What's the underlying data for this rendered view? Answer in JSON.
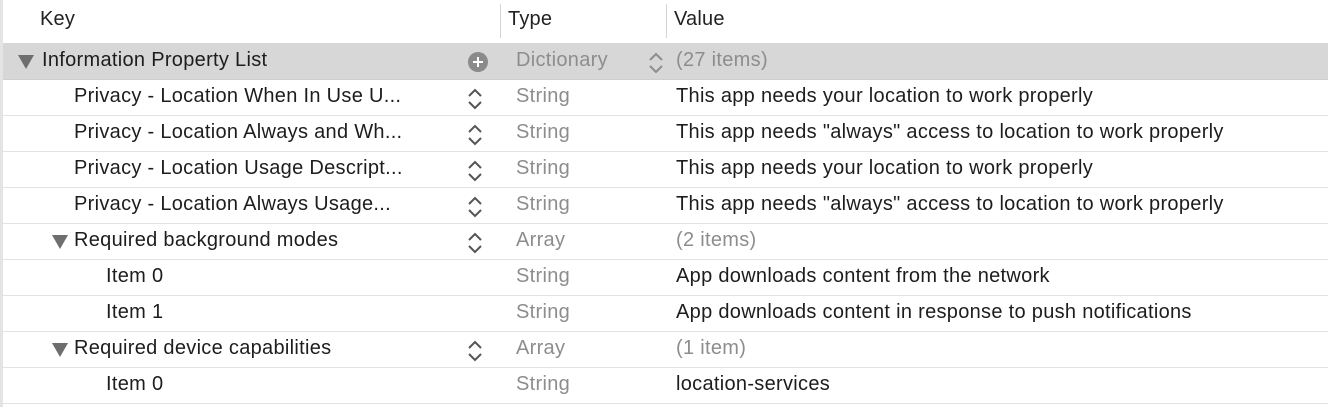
{
  "header": {
    "key_label": "Key",
    "type_label": "Type",
    "value_label": "Value"
  },
  "rows": [
    {
      "key": "Information Property List",
      "type": "Dictionary",
      "value": "(27 items)"
    },
    {
      "key": "Privacy - Location When In Use U...",
      "type": "String",
      "value": "This app needs your location to work properly"
    },
    {
      "key": "Privacy - Location Always and Wh...",
      "type": "String",
      "value": "This app needs \"always\" access to location to work properly"
    },
    {
      "key": "Privacy - Location Usage Descript...",
      "type": "String",
      "value": "This app needs your location to work properly"
    },
    {
      "key": "Privacy - Location Always Usage...",
      "type": "String",
      "value": "This app needs \"always\" access to location to work properly"
    },
    {
      "key": "Required background modes",
      "type": "Array",
      "value": "(2 items)"
    },
    {
      "key": "Item 0",
      "type": "String",
      "value": "App downloads content from the network"
    },
    {
      "key": "Item 1",
      "type": "String",
      "value": "App downloads content in response to push notifications"
    },
    {
      "key": "Required device capabilities",
      "type": "Array",
      "value": "(1 item)"
    },
    {
      "key": "Item 0",
      "type": "String",
      "value": "location-services"
    }
  ],
  "icons": {
    "disclosure": "disclosure-triangle-icon",
    "stepper": "up-down-stepper-icon",
    "add": "add-circle-icon"
  },
  "colors": {
    "selected_row": "#d7d7d7",
    "muted_text": "#8d8d8d",
    "text": "#1d1d1d"
  }
}
